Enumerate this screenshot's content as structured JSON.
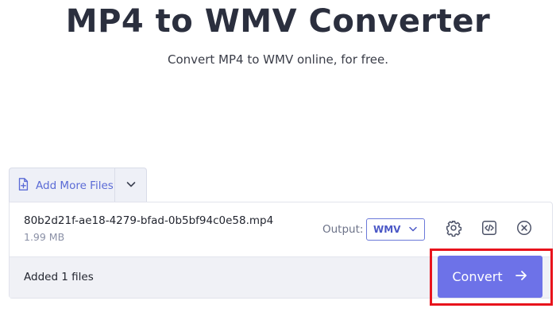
{
  "header": {
    "title": "MP4 to WMV Converter",
    "subtitle": "Convert MP4 to WMV online, for free."
  },
  "toolbar": {
    "add_files_label": "Add More Files",
    "add_files_icon": "file-plus-icon",
    "dropdown_icon": "chevron-down-icon"
  },
  "file": {
    "name": "80b2d21f-ae18-4279-bfad-0b5bf94c0e58.mp4",
    "size": "1.99 MB",
    "output_label": "Output:",
    "output_format": "WMV",
    "actions": [
      "gear-icon",
      "embed-code-icon",
      "close-circle-icon"
    ]
  },
  "footer": {
    "added_text": "Added 1 files",
    "convert_label": "Convert"
  },
  "colors": {
    "accent": "#6d72e8",
    "link": "#5b6bd6",
    "highlight": "#e8131c"
  }
}
